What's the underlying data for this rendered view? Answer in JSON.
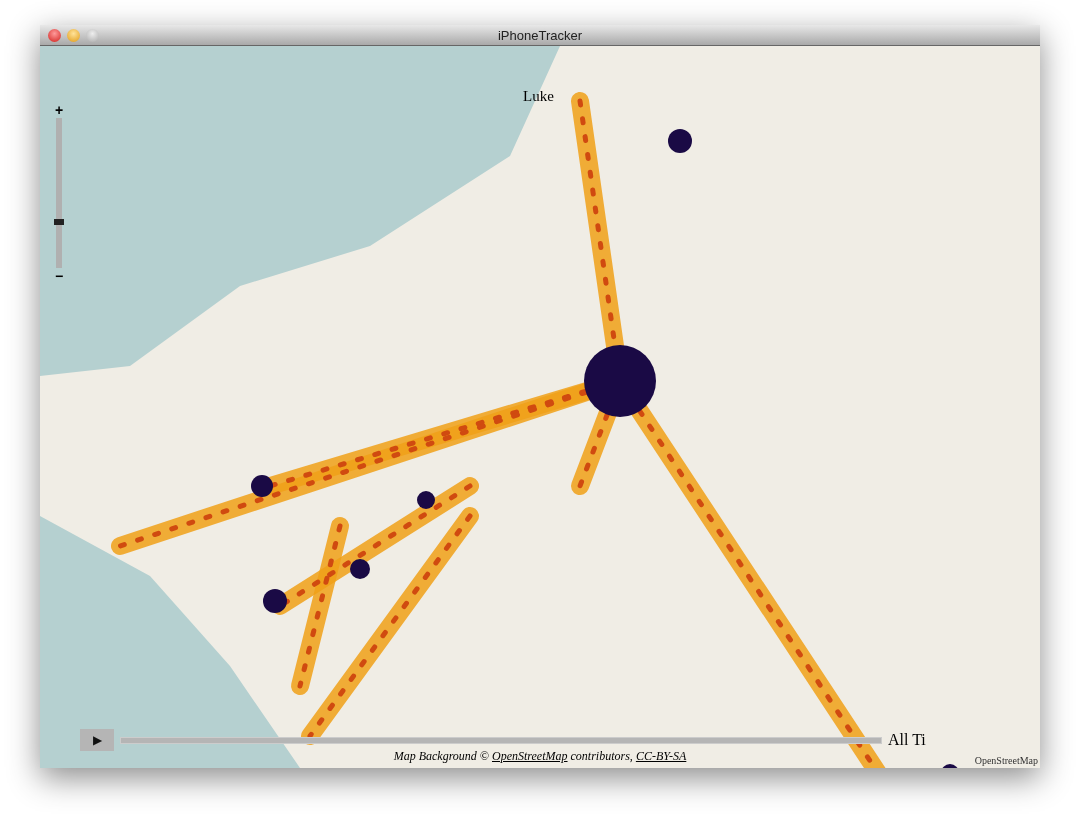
{
  "window": {
    "title": "iPhoneTracker"
  },
  "map": {
    "zoom": {
      "zoom_in": "+",
      "zoom_out": "−",
      "level": 0.3
    },
    "track_label": "Luke",
    "timeline": {
      "play": "▶",
      "level": 1,
      "range_label": "All Ti"
    },
    "attribution": {
      "prefix": "Map Background ©",
      "link": "OpenStreetMap",
      "middle": "contributors,",
      "license": "CC-BY-SA"
    },
    "corner_credit": "OpenStreetMap"
  }
}
